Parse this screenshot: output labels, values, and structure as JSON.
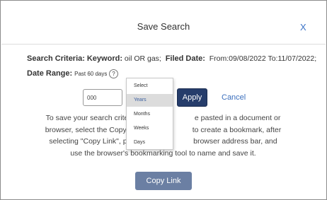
{
  "dialog": {
    "title": "Save Search",
    "close_label": "X"
  },
  "criteria": {
    "label": "Search Criteria:",
    "keyword_label": "Keyword:",
    "keyword_value": "oil OR gas;",
    "filed_label": "Filed Date:",
    "filed_value": "From:09/08/2022 To:11/07/2022;"
  },
  "date_range": {
    "label": "Date Range:",
    "value": "Past 60 days",
    "help_symbol": "?"
  },
  "range_controls": {
    "number_value": "000",
    "apply_label": "Apply",
    "cancel_label": "Cancel",
    "unit_options": [
      "Select",
      "Years",
      "Months",
      "Weeks",
      "Days"
    ],
    "selected_unit": "Years"
  },
  "info_text": {
    "line1a": "To save your search criteria in a",
    "line1b": "e pasted in a document or",
    "line2a": "browser, select the Copy Link b",
    "line2b": "to create a bookmark, after",
    "line3a": "selecting \"Copy Link\", paste th",
    "line3b": "browser address bar, and",
    "line4": "use the browser's bookmarking tool to name and save it."
  },
  "copy_link_label": "Copy Link"
}
